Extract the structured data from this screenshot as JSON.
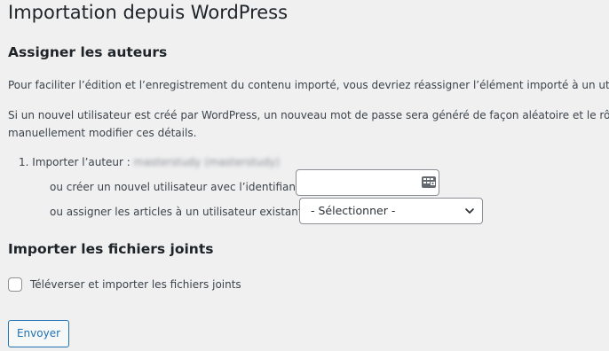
{
  "page": {
    "title": "Importation depuis WordPress"
  },
  "assign_authors": {
    "heading": "Assigner les auteurs",
    "paragraph_1": "Pour faciliter l’édition et l’enregistrement du contenu importé, vous devriez réassigner l’élément importé à un utilisat",
    "paragraph_2_line_1": "Si un nouvel utilisateur est créé par WordPress, un nouveau mot de passe sera généré de façon aléatoire et le rôle c",
    "paragraph_2_line_2": "manuellement modifier ces détails.",
    "item_number": "1.",
    "import_author_label": "Importer l’auteur :",
    "author_name_blurred": "masterstudy (masterstudy)",
    "create_user_label": "ou créer un nouvel utilisateur avec l’identifiant :",
    "create_user_input_value": "",
    "assign_existing_label": "ou assigner les articles à un utilisateur existant :",
    "existing_user_select_value": "- Sélectionner -"
  },
  "attachments": {
    "heading": "Importer les fichiers joints",
    "checkbox_label": "Téléverser et importer les fichiers joints",
    "checkbox_checked": false
  },
  "actions": {
    "submit_label": "Envoyer"
  },
  "icons": {
    "input_icon": "id-card-icon",
    "select_chevron": "chevron-down-icon"
  },
  "colors": {
    "background": "#f0f0f1",
    "text": "#3c434a",
    "heading": "#1d2327",
    "border": "#8c8f94",
    "primary": "#2271b1"
  }
}
